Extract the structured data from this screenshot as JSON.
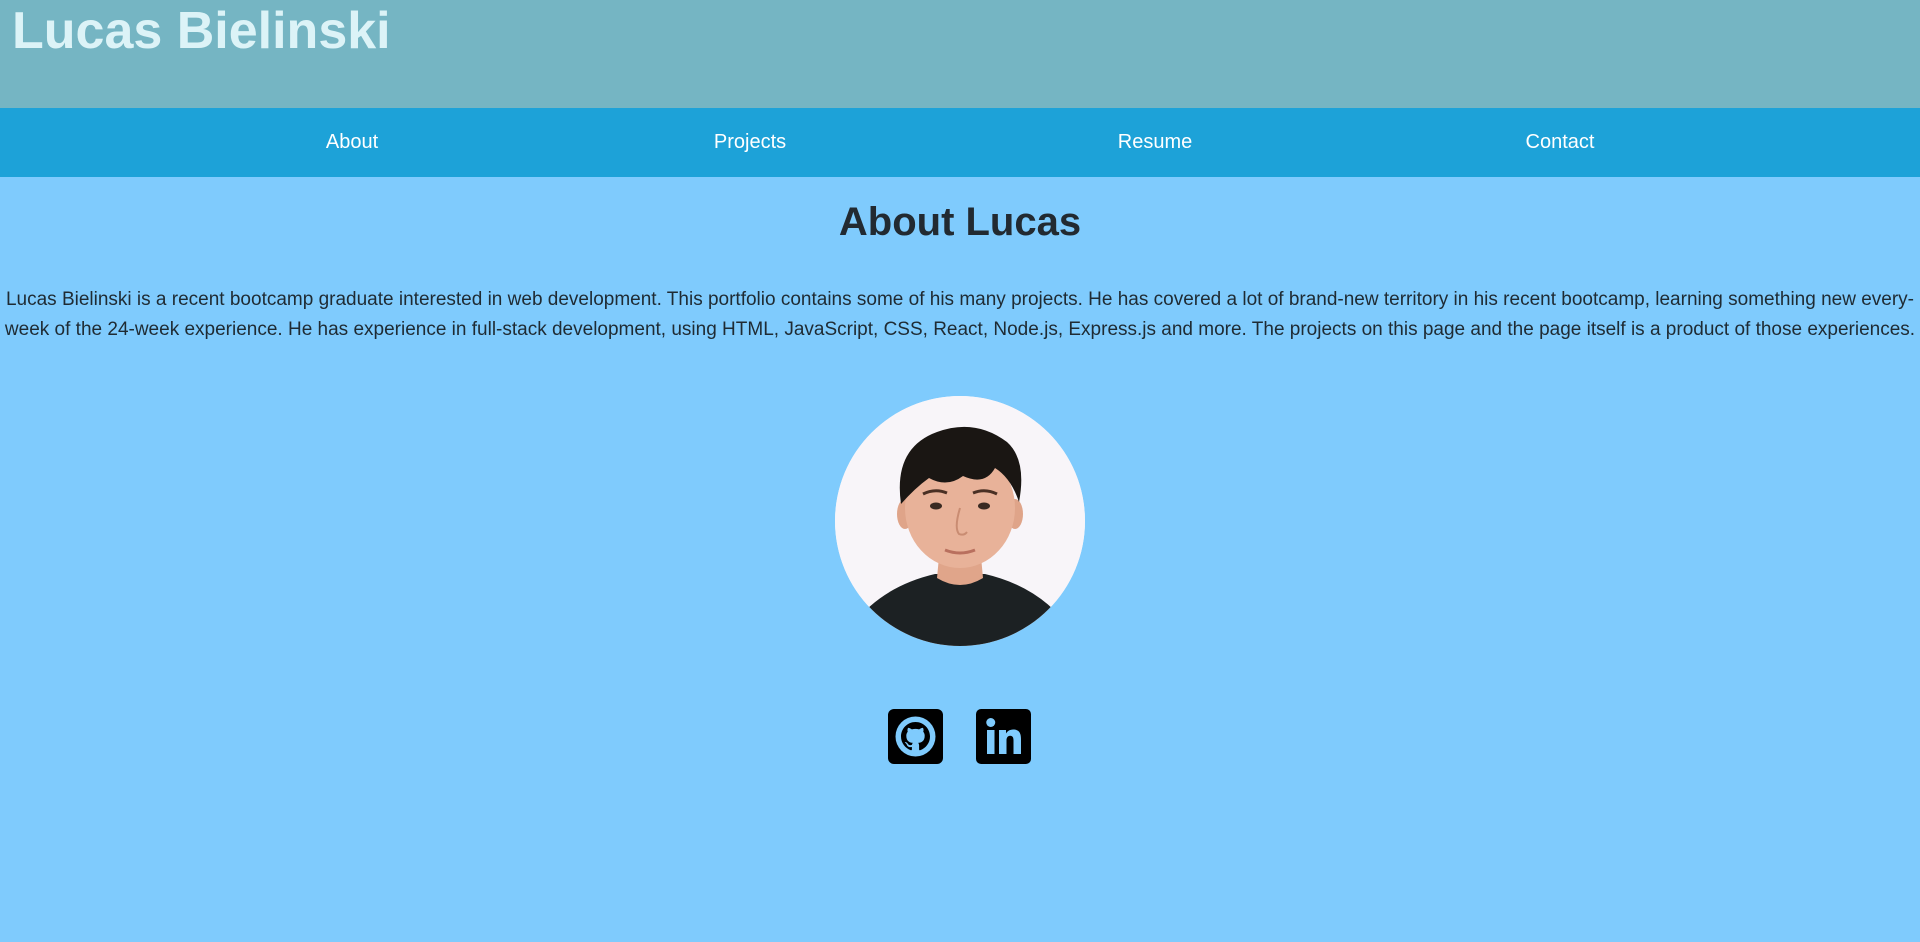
{
  "header": {
    "title": "Lucas Bielinski"
  },
  "nav": {
    "items": [
      {
        "label": "About"
      },
      {
        "label": "Projects"
      },
      {
        "label": "Resume"
      },
      {
        "label": "Contact"
      }
    ]
  },
  "about": {
    "heading": "About Lucas",
    "bio": "Lucas Bielinski is a recent bootcamp graduate interested in web development. This portfolio contains some of his many projects. He has covered a lot of brand-new territory in his recent bootcamp, learning something new every-week of the 24-week experience. He has experience in full-stack development, using HTML, JavaScript, CSS, React, Node.js, Express.js and more. The projects on this page and the page itself is a product of those experiences."
  },
  "social": {
    "github_icon": "github-icon",
    "linkedin_icon": "linkedin-icon"
  },
  "colors": {
    "header_bg": "#75b5c3",
    "nav_bg": "#1da2d8",
    "page_bg": "#7fcbfd",
    "title_text": "#dcf3f7"
  }
}
